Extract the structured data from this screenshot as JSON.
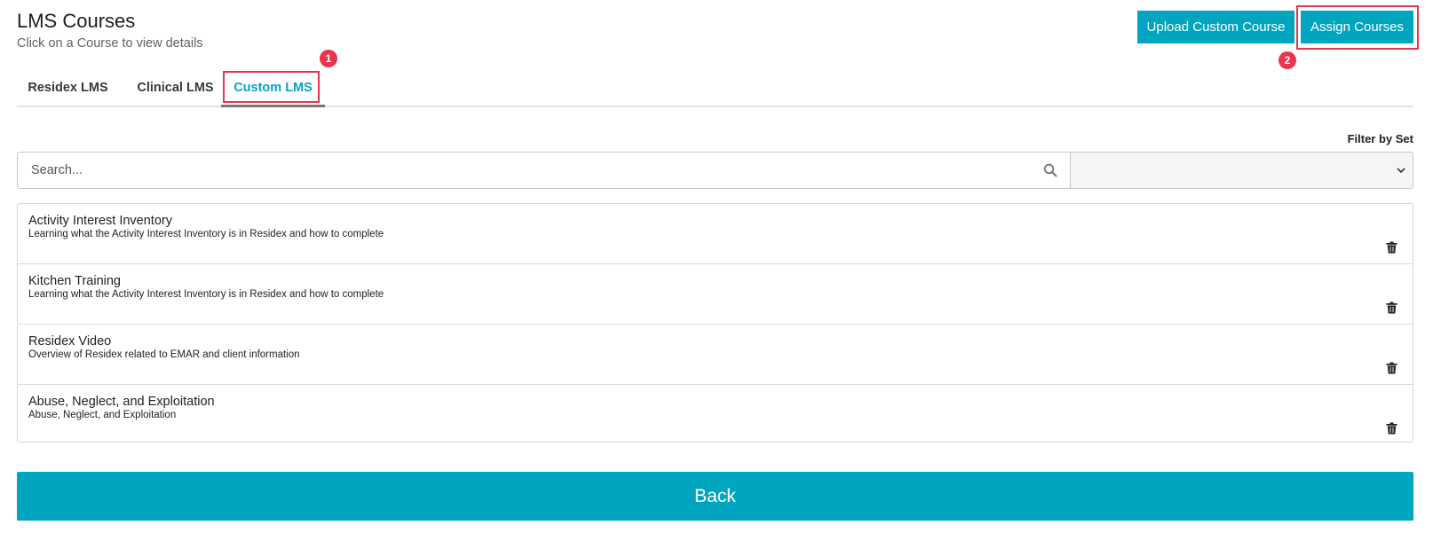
{
  "header": {
    "title": "LMS Courses",
    "subtitle": "Click on a Course to view details"
  },
  "actions": {
    "upload_label": "Upload Custom Course",
    "assign_label": "Assign Courses"
  },
  "annotations": {
    "marker_1": "1",
    "marker_2": "2"
  },
  "tabs": [
    {
      "label": "Residex LMS",
      "active": false
    },
    {
      "label": "Clinical LMS",
      "active": false
    },
    {
      "label": "Custom LMS",
      "active": true
    }
  ],
  "filter": {
    "label": "Filter by Set",
    "selected": ""
  },
  "search": {
    "placeholder": "Search...",
    "value": ""
  },
  "courses": [
    {
      "title": "Activity Interest Inventory",
      "description": "Learning what the Activity Interest Inventory is in Residex and how to complete"
    },
    {
      "title": "Kitchen Training",
      "description": "Learning what the Activity Interest Inventory is in Residex and how to complete"
    },
    {
      "title": "Residex Video",
      "description": "Overview of Residex related to EMAR and client information"
    },
    {
      "title": "Abuse, Neglect, and Exploitation",
      "description": "Abuse, Neglect, and Exploitation"
    }
  ],
  "footer": {
    "back_label": "Back"
  },
  "colors": {
    "accent": "#00a6c0",
    "active_tab": "#0d9fce",
    "highlight": "#e8364f"
  },
  "icons": {
    "search": "search-icon",
    "dropdown": "chevron-down-icon",
    "delete": "trash-icon"
  }
}
